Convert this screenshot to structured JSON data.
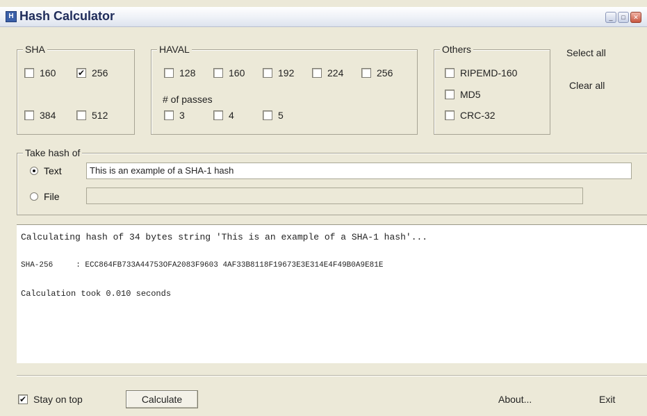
{
  "window": {
    "title": "Hash Calculator",
    "icon_glyph": "H",
    "controls": {
      "minimize": "_",
      "maximize": "□",
      "close": "✕"
    }
  },
  "sha": {
    "legend": "SHA",
    "options": [
      {
        "label": "160",
        "checked": false
      },
      {
        "label": "256",
        "checked": true
      },
      {
        "label": "384",
        "checked": false
      },
      {
        "label": "512",
        "checked": false
      }
    ]
  },
  "haval": {
    "legend": "HAVAL",
    "options": [
      {
        "label": "128",
        "checked": false
      },
      {
        "label": "160",
        "checked": false
      },
      {
        "label": "192",
        "checked": false
      },
      {
        "label": "224",
        "checked": false
      },
      {
        "label": "256",
        "checked": false
      }
    ],
    "passes_label": "# of passes",
    "passes": [
      {
        "label": "3",
        "checked": false
      },
      {
        "label": "4",
        "checked": false
      },
      {
        "label": "5",
        "checked": false
      }
    ]
  },
  "others": {
    "legend": "Others",
    "options": [
      {
        "label": "RIPEMD-160",
        "checked": false
      },
      {
        "label": "MD5",
        "checked": false
      },
      {
        "label": "CRC-32",
        "checked": false
      }
    ]
  },
  "actions": {
    "select_all": "Select all",
    "clear_all": "Clear all"
  },
  "take_hash": {
    "legend": "Take hash of",
    "text_label": "Text",
    "text_value": "This is an example of a SHA-1 hash",
    "file_label": "File",
    "file_value": "",
    "selected": "text"
  },
  "output": {
    "lines": [
      "Calculating hash of 34 bytes string 'This is an example of a SHA-1 hash'...",
      "SHA-256     : ECC864FB733A44753OFA2083F9603 4AF33B8118F19673E3E314E4F49B0A9E81E",
      "Calculation took 0.010 seconds"
    ]
  },
  "footer": {
    "stay_on_top_label": "Stay on top",
    "stay_on_top_checked": true,
    "calculate_label": "Calculate",
    "about_label": "About...",
    "exit_label": "Exit"
  },
  "colors": {
    "window_bg": "#ece9d8",
    "title_text": "#1f2c5a"
  }
}
